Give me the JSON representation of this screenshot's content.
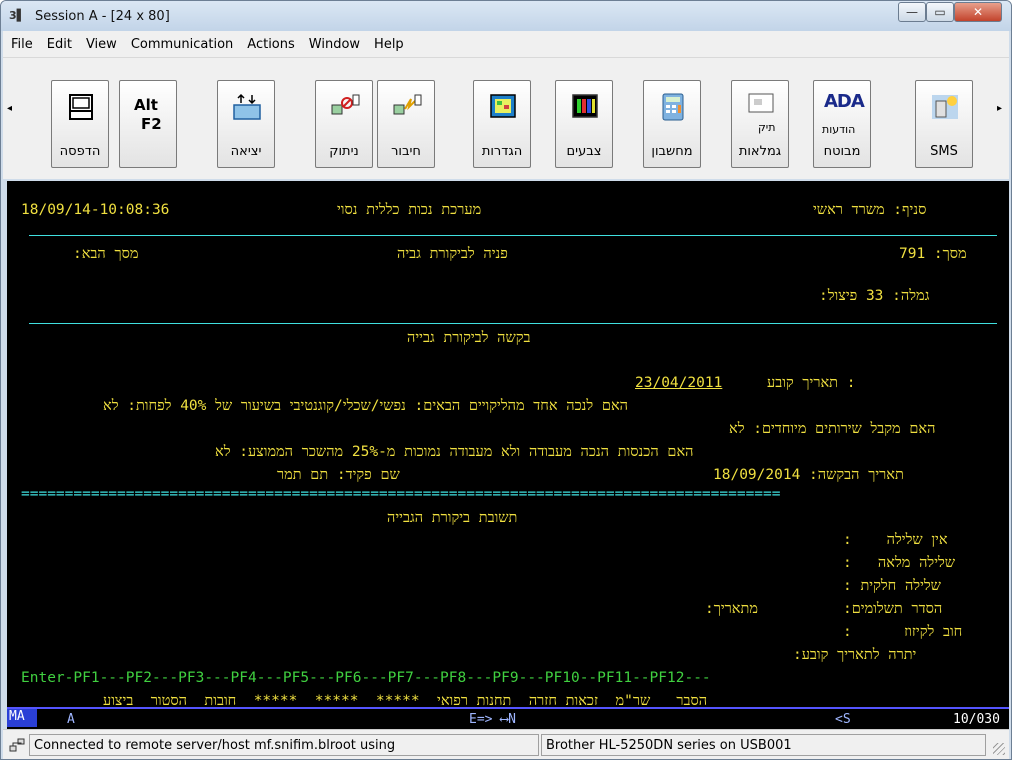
{
  "window": {
    "app_icon": "3▌",
    "title": "Session A - [24 x 80]",
    "min": "—",
    "max": "▭",
    "close": "✕"
  },
  "menu": [
    "File",
    "Edit",
    "View",
    "Communication",
    "Actions",
    "Window",
    "Help"
  ],
  "toolbar": {
    "scroll_left": "◂",
    "scroll_right": "▸",
    "buttons": [
      {
        "label": "הדפסה",
        "icon": "printer-icon"
      },
      {
        "label": "F2",
        "icon_text": "Alt",
        "icon": "alt-f2-icon"
      },
      {
        "label": "יציאה",
        "icon": "exit-icon"
      },
      {
        "label": "ניתוק",
        "icon": "disconnect-icon"
      },
      {
        "label": "חיבור",
        "icon": "connect-icon"
      },
      {
        "label": "הגדרות",
        "icon": "settings-icon"
      },
      {
        "label": "צבעים",
        "icon": "colors-icon"
      },
      {
        "label": "מחשבון",
        "icon": "calculator-icon"
      },
      {
        "label": "גמלאות",
        "icon": "pension-file-icon",
        "icon_text": "תיק"
      },
      {
        "label": "מבוטח",
        "icon": "ada-icon",
        "icon_text": "ADA",
        "icon_sub": "הודעות"
      },
      {
        "label": "SMS",
        "icon": "sms-icon"
      }
    ]
  },
  "terminal": {
    "header_datetime": "18/09/14-10:08:36",
    "header_system": "מערכת נכות כללית נסוי",
    "header_branch": "סניף: משרד ראשי",
    "screen_next": "מסך הבא:",
    "screen_title": "פניה לביקורת גביה",
    "screen_num": "791 :מסך",
    "gimla_line": "גמלה: 33 פיצול:",
    "request_title": "בקשה לביקורת גבייה",
    "fixed_date_value": "23/04/2011",
    "fixed_date_label": ": תאריך קובע",
    "q1": "האם לנכה אחד מהליקויים הבאים: נפשי/שכלי/קוגנטיבי בשיעור של 40% לפחות: לא",
    "q2": "האם מקבל שירותים מיוחדים: לא",
    "q3": "האם הכנסות הנכה מעבודה ולא מעבודה נמוכות מ-25% מהשכר הממוצע: לא",
    "clerk": "שם פקיד: תם תמר",
    "request_date": "תאריך הבקשה: 18/09/2014",
    "separator": "=======================================================================================",
    "response_title": "תשובת ביקורת הגבייה",
    "r1": "אין שלילה    :",
    "r2": "שלילה מלאה   :",
    "r3": "שלילה חלקית :",
    "r4_from": "מתאריך:",
    "r4": "הסדר תשלומים:",
    "r5": "חוב לקיזוז      :",
    "r6": "יתרה לתאריך קובע:",
    "pf_keys": "Enter-PF1---PF2---PF3---PF4---PF5---PF6---PF7---PF8---PF9---PF10--PF11--PF12---",
    "pf_desc": "הסבר   שר\"מ  זכאות חזרה  תחנות רפואי  *****  *****  *****  חובות  הסטור  ביצוע"
  },
  "oia": {
    "ma": "MA",
    "mode": "A",
    "arrows": "E=> ⟷N",
    "lt": "<S",
    "pos": "10/030"
  },
  "status": {
    "icon": "network-icon",
    "connection": "Connected to remote server/host mf.snifim.blroot using",
    "printer": "Brother HL-5250DN series on USB001"
  }
}
